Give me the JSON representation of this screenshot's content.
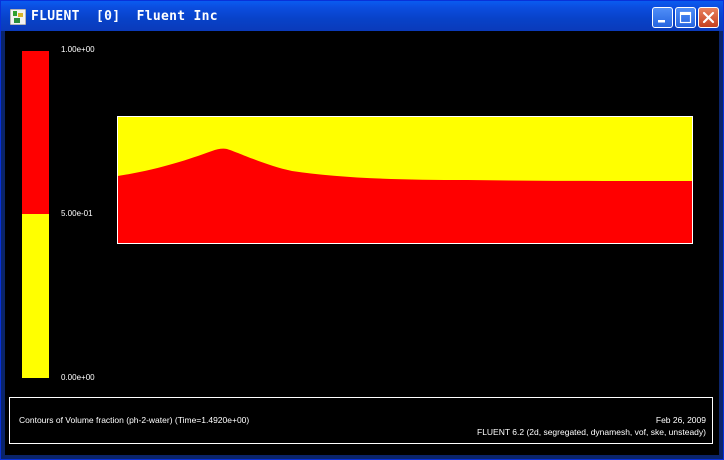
{
  "window": {
    "title": "FLUENT  [0]  Fluent Inc",
    "buttons": {
      "minimize_icon": "minimize-icon",
      "maximize_icon": "maximize-icon",
      "close_icon": "close-icon"
    }
  },
  "colorbar": {
    "labels": {
      "max": "1.00e+00",
      "mid": "5.00e-01",
      "min": "0.00e+00"
    },
    "colors": {
      "high": "#ff0000",
      "low": "#ffff00",
      "background": "#000000"
    }
  },
  "plot": {
    "border_color": "#ffffff"
  },
  "info": {
    "caption": "Contours of Volume fraction (ph-2-water)  (Time=1.4920e+00)",
    "date": "Feb 26, 2009",
    "version": "FLUENT 6.2 (2d, segregated, dynamesh, vof, ske, unsteady)"
  }
}
